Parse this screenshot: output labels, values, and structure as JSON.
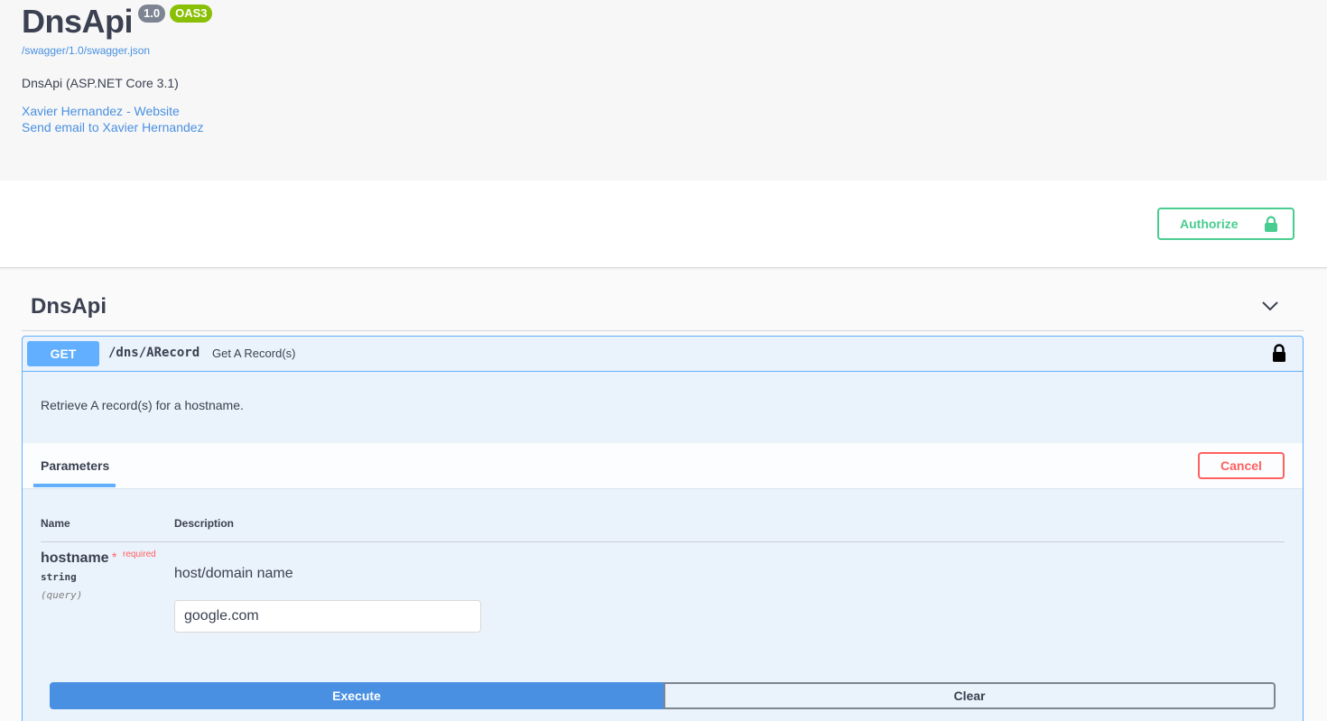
{
  "info": {
    "title": "DnsApi",
    "version_badge": "1.0",
    "oas_badge": "OAS3",
    "spec_link": "/swagger/1.0/swagger.json",
    "description": "DnsApi (ASP.NET Core 3.1)",
    "contact_website": "Xavier Hernandez - Website",
    "contact_email": "Send email to Xavier Hernandez"
  },
  "scheme": {
    "authorize_label": "Authorize",
    "authorize_icon": "unlocked-padlock-icon"
  },
  "tag": {
    "title": "DnsApi",
    "toggle_icon": "chevron-down-icon"
  },
  "operation": {
    "method": "GET",
    "path": "/dns/ARecord",
    "summary": "Get A Record(s)",
    "lock_icon": "locked-padlock-icon",
    "description": "Retrieve A record(s) for a hostname.",
    "parameters_tab": "Parameters",
    "cancel_label": "Cancel",
    "columns": {
      "name": "Name",
      "description": "Description"
    },
    "parameter": {
      "name": "hostname",
      "required_marker": "*",
      "required_label": "required",
      "type": "string",
      "in": "(query)",
      "description": "host/domain name",
      "value": "google.com"
    },
    "execute_label": "Execute",
    "clear_label": "Clear"
  },
  "colors": {
    "get_blue": "#61affe",
    "authorize_green": "#49cc90",
    "cancel_red": "#ff6060",
    "execute_blue": "#4990e2",
    "badge_gray": "#7d8492",
    "oas_green": "#89bf04",
    "link_blue": "#4990e2"
  }
}
